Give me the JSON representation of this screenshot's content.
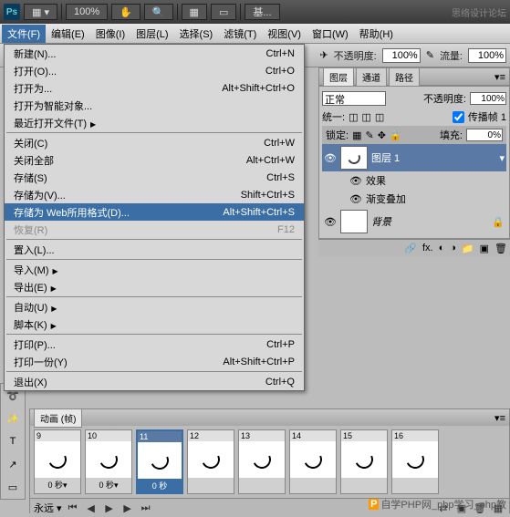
{
  "topbar": {
    "logo": "Ps",
    "zoom": "100%",
    "doc": "基...",
    "site": "思络设计论坛"
  },
  "menubar": [
    "文件(F)",
    "编辑(E)",
    "图像(I)",
    "图层(L)",
    "选择(S)",
    "滤镜(T)",
    "视图(V)",
    "窗口(W)",
    "帮助(H)"
  ],
  "optbar": {
    "opacity_lbl": "不透明度:",
    "opacity": "100%",
    "flow_lbl": "流量:",
    "flow": "100%"
  },
  "file_menu": [
    {
      "l": "新建(N)...",
      "s": "Ctrl+N"
    },
    {
      "l": "打开(O)...",
      "s": "Ctrl+O"
    },
    {
      "l": "打开为...",
      "s": "Alt+Shift+Ctrl+O"
    },
    {
      "l": "打开为智能对象...",
      "s": ""
    },
    {
      "l": "最近打开文件(T)",
      "s": "",
      "sub": true
    },
    {
      "sep": true
    },
    {
      "l": "关闭(C)",
      "s": "Ctrl+W"
    },
    {
      "l": "关闭全部",
      "s": "Alt+Ctrl+W"
    },
    {
      "l": "存储(S)",
      "s": "Ctrl+S"
    },
    {
      "l": "存储为(V)...",
      "s": "Shift+Ctrl+S"
    },
    {
      "l": "存储为 Web所用格式(D)...",
      "s": "Alt+Shift+Ctrl+S",
      "sel": true
    },
    {
      "l": "恢复(R)",
      "s": "F12",
      "dis": true
    },
    {
      "sep": true
    },
    {
      "l": "置入(L)...",
      "s": ""
    },
    {
      "sep": true
    },
    {
      "l": "导入(M)",
      "s": "",
      "sub": true
    },
    {
      "l": "导出(E)",
      "s": "",
      "sub": true
    },
    {
      "sep": true
    },
    {
      "l": "自动(U)",
      "s": "",
      "sub": true
    },
    {
      "l": "脚本(K)",
      "s": "",
      "sub": true
    },
    {
      "sep": true
    },
    {
      "l": "打印(P)...",
      "s": "Ctrl+P"
    },
    {
      "l": "打印一份(Y)",
      "s": "Alt+Shift+Ctrl+P"
    },
    {
      "sep": true
    },
    {
      "l": "退出(X)",
      "s": "Ctrl+Q"
    }
  ],
  "layers": {
    "tabs": [
      "图层",
      "通道",
      "路径"
    ],
    "mode": "正常",
    "opacity_lbl": "不透明度:",
    "opacity": "100%",
    "unify": "统一:",
    "propagate": "传播帧 1",
    "lock": "锁定:",
    "fill_lbl": "填充:",
    "fill": "0%",
    "layer1": "图层 1",
    "effects": "效果",
    "grad": "渐变叠加",
    "bg": "背景"
  },
  "anim": {
    "title": "动画 (帧)",
    "frames": [
      {
        "n": "9",
        "t": "0 秒▾"
      },
      {
        "n": "10",
        "t": "0 秒▾"
      },
      {
        "n": "11",
        "t": "0 秒",
        "sel": true
      },
      {
        "n": "12",
        "t": ""
      },
      {
        "n": "13",
        "t": ""
      },
      {
        "n": "14",
        "t": ""
      },
      {
        "n": "15",
        "t": ""
      },
      {
        "n": "16",
        "t": ""
      }
    ],
    "loop": "永远 ▾"
  },
  "watermark": {
    "badge": "P",
    "text": "自学PHP网_php学习_php教"
  }
}
